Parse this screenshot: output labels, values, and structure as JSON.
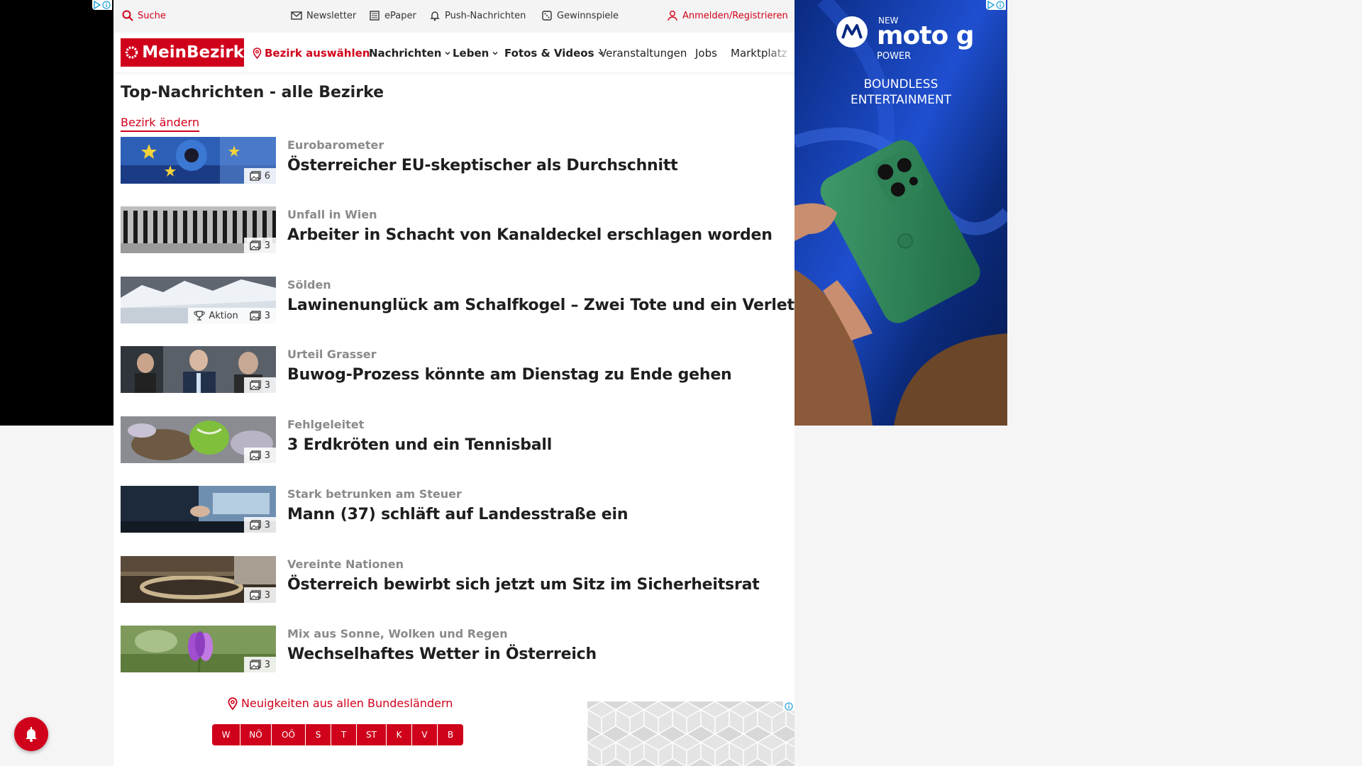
{
  "utility": {
    "search": "Suche",
    "newsletter": "Newsletter",
    "epaper": "ePaper",
    "push": "Push-Nachrichten",
    "games": "Gewinnspiele",
    "login": "Anmelden/Registrieren"
  },
  "nav": {
    "logo": "MeinBezirk",
    "district": "Bezirk auswählen",
    "items": [
      "Nachrichten",
      "Leben",
      "Fotos & Videos",
      "Veranstaltungen",
      "Jobs",
      "Marktplatz"
    ]
  },
  "section": {
    "title": "Top-Nachrichten - alle Bezirke",
    "change": "Bezirk ändern"
  },
  "articles": [
    {
      "kicker": "Eurobarometer",
      "headline": "Österreicher EU-skeptischer als Durchschnitt",
      "photos": "6"
    },
    {
      "kicker": "Unfall in Wien",
      "headline": "Arbeiter in Schacht von Kanaldeckel erschlagen worden",
      "photos": "3"
    },
    {
      "kicker": "Sölden",
      "headline": "Lawinenunglück am Schalfkogel – Zwei Tote und ein Verletzter",
      "photos": "3",
      "badge": "Aktion"
    },
    {
      "kicker": "Urteil Grasser",
      "headline": "Buwog-Prozess könnte am Dienstag zu Ende gehen",
      "photos": "3"
    },
    {
      "kicker": "Fehlgeleitet",
      "headline": "3 Erdkröten und ein Tennisball",
      "photos": "3"
    },
    {
      "kicker": "Stark betrunken am Steuer",
      "headline": "Mann (37) schläft auf Landesstraße ein",
      "photos": "3"
    },
    {
      "kicker": "Vereinte Nationen",
      "headline": "Österreich bewirbt sich jetzt um Sitz im Sicherheitsrat",
      "photos": "3"
    },
    {
      "kicker": "Mix aus Sonne, Wolken und Regen",
      "headline": "Wechselhaftes Wetter in Österreich",
      "photos": "3"
    }
  ],
  "states": {
    "title": "Neuigkeiten aus allen Bundesländern",
    "items": [
      "W",
      "NÖ",
      "OÖ",
      "S",
      "T",
      "ST",
      "K",
      "V",
      "B"
    ]
  },
  "ad": {
    "new": "NEW",
    "brand": "moto g",
    "power": "POWER",
    "tagline1": "BOUNDLESS",
    "tagline2": "ENTERTAINMENT"
  }
}
